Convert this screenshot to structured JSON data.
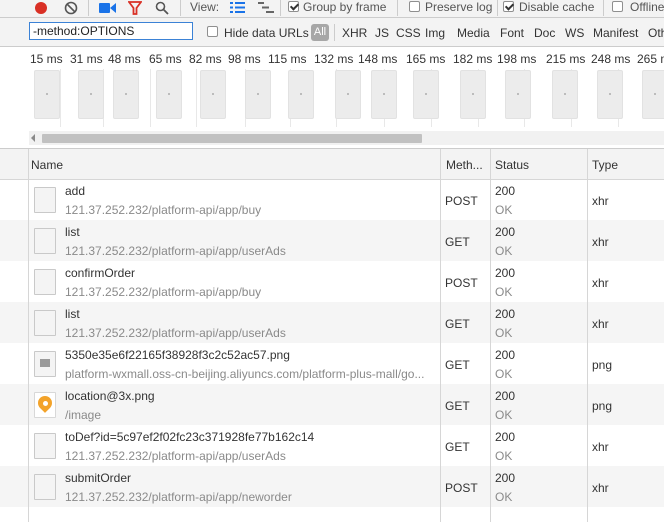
{
  "toolbar": {
    "view_label": "View:",
    "group_by_frame_label": "Group by frame",
    "group_by_frame_checked": true,
    "preserve_log_label": "Preserve log",
    "preserve_log_checked": false,
    "disable_cache_label": "Disable cache",
    "disable_cache_checked": true,
    "offline_label": "Offline",
    "offline_checked": false,
    "record_color": "#d93025",
    "filter_color": "#d93025",
    "video_icon_color": "#1a73e8",
    "list_view_color": "#1a73e8"
  },
  "filterbar": {
    "filter_value": "-method:OPTIONS",
    "hide_data_urls_label": "Hide data URLs",
    "hide_data_urls_checked": false,
    "types": [
      "All",
      "XHR",
      "JS",
      "CSS",
      "Img",
      "Media",
      "Font",
      "Doc",
      "WS",
      "Manifest",
      "Oth"
    ],
    "selected_type": "All"
  },
  "overview": {
    "ticks": [
      "15 ms",
      "31 ms",
      "48 ms",
      "65 ms",
      "82 ms",
      "98 ms",
      "115 ms",
      "132 ms",
      "148 ms",
      "165 ms",
      "182 ms",
      "198 ms",
      "215 ms",
      "248 ms",
      "265 ms"
    ]
  },
  "grid": {
    "columns": [
      "Name",
      "Meth...",
      "Status",
      "Type"
    ],
    "rows": [
      {
        "name": "add",
        "path": "121.37.252.232/platform-api/app/buy",
        "method": "POST",
        "status": "200",
        "status_text": "OK",
        "type": "xhr",
        "icon": "document-icon"
      },
      {
        "name": "list",
        "path": "121.37.252.232/platform-api/app/userAds",
        "method": "GET",
        "status": "200",
        "status_text": "OK",
        "type": "xhr",
        "icon": "document-icon"
      },
      {
        "name": "confirmOrder",
        "path": "121.37.252.232/platform-api/app/buy",
        "method": "POST",
        "status": "200",
        "status_text": "OK",
        "type": "xhr",
        "icon": "document-icon"
      },
      {
        "name": "list",
        "path": "121.37.252.232/platform-api/app/userAds",
        "method": "GET",
        "status": "200",
        "status_text": "OK",
        "type": "xhr",
        "icon": "document-icon"
      },
      {
        "name": "5350e35e6f22165f38928f3c2c52ac57.png",
        "path": "platform-wxmall.oss-cn-beijing.aliyuncs.com/platform-plus-mall/go...",
        "method": "GET",
        "status": "200",
        "status_text": "OK",
        "type": "png",
        "icon": "image-icon"
      },
      {
        "name": "location@3x.png",
        "path": "/image",
        "method": "GET",
        "status": "200",
        "status_text": "OK",
        "type": "png",
        "icon": "location-pin-icon"
      },
      {
        "name": "toDef?id=5c97ef2f02fc23c371928fe77b162c14",
        "path": "121.37.252.232/platform-api/app/userAds",
        "method": "GET",
        "status": "200",
        "status_text": "OK",
        "type": "xhr",
        "icon": "document-icon"
      },
      {
        "name": "submitOrder",
        "path": "121.37.252.232/platform-api/app/neworder",
        "method": "POST",
        "status": "200",
        "status_text": "OK",
        "type": "xhr",
        "icon": "document-icon"
      }
    ]
  }
}
